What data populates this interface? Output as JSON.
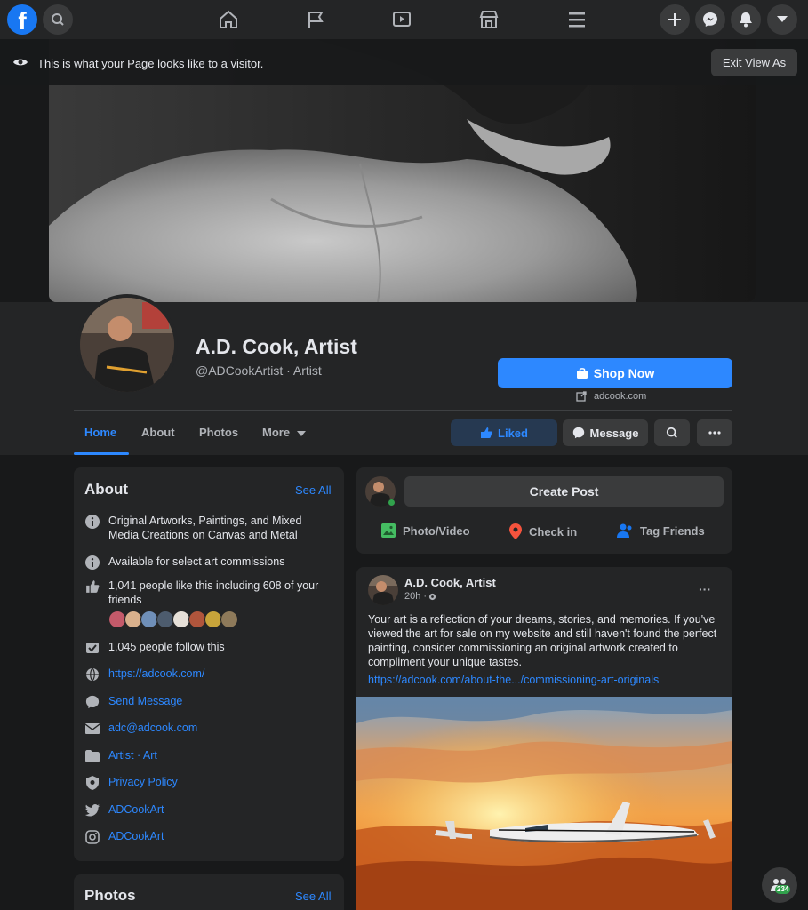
{
  "nav": {
    "logo": "f",
    "icons": [
      "search-icon",
      "home-icon",
      "flag-icon",
      "watch-icon",
      "marketplace-icon",
      "menu-icon",
      "plus-icon",
      "messenger-icon",
      "notifications-icon",
      "caret-down-icon"
    ]
  },
  "banner": {
    "text": "This is what your Page looks like to a visitor.",
    "exit_label": "Exit View As"
  },
  "profile": {
    "name": "A.D. Cook, Artist",
    "handle": "@ADCookArtist · Artist",
    "shop_label": "Shop Now",
    "website": "adcook.com"
  },
  "tabs": [
    {
      "label": "Home"
    },
    {
      "label": "About"
    },
    {
      "label": "Photos"
    },
    {
      "label": "More"
    }
  ],
  "actions": {
    "liked": "Liked",
    "message": "Message"
  },
  "about": {
    "title": "About",
    "see_all": "See All",
    "description": "Original Artworks, Paintings, and Mixed Media Creations on Canvas and Metal",
    "commissions": "Available for select art commissions",
    "likes": "1,041 people like this including 608 of your friends",
    "follows": "1,045 people follow this",
    "website": "https://adcook.com/",
    "send_message": "Send Message",
    "email": "adc@adcook.com",
    "category": "Artist · Art",
    "privacy": "Privacy Policy",
    "twitter": "ADCookArt",
    "instagram": "ADCookArt"
  },
  "photos": {
    "title": "Photos",
    "see_all": "See All"
  },
  "composer": {
    "create_post": "Create Post",
    "photo_video": "Photo/Video",
    "check_in": "Check in",
    "tag_friends": "Tag Friends"
  },
  "post": {
    "author": "A.D. Cook, Artist",
    "time": "20h · ",
    "body": "Your art is a reflection of your dreams, stories, and memories. If you've viewed the art for sale on my website and still haven't found the perfect painting, consider commissioning an original artwork created to compliment your unique tastes.",
    "link": "https://adcook.com/about-the.../commissioning-art-originals",
    "more": "···"
  },
  "float_badge": "234",
  "colors": {
    "accent": "#2d88ff",
    "background": "#18191a",
    "card": "#242526"
  }
}
